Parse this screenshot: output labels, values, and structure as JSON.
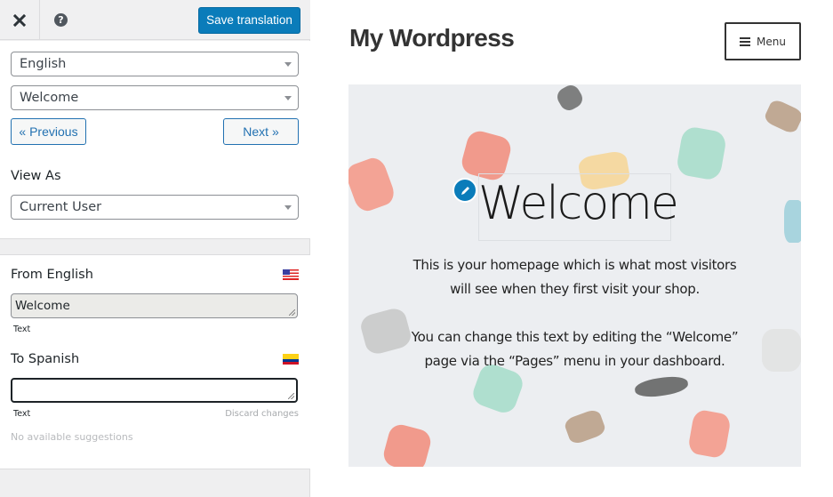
{
  "sidebar": {
    "topbar": {
      "close_icon": "close-icon",
      "help_icon": "help-icon",
      "help_glyph": "?",
      "save_label": "Save translation",
      "save_color": "#0a7cba"
    },
    "language_select": {
      "value": "English"
    },
    "string_select": {
      "value": "Welcome"
    },
    "previous_label": "« Previous",
    "next_label": "Next »",
    "view_as": {
      "label": "View As",
      "value": "Current User"
    },
    "source": {
      "label": "From English",
      "flag": "us-flag",
      "value": "Welcome",
      "type_label": "Text"
    },
    "target": {
      "label": "To Spanish",
      "flag": "colombia-flag",
      "value": "",
      "type_label": "Text",
      "discard_label": "Discard changes",
      "suggestions_text": "No available suggestions"
    }
  },
  "preview": {
    "site_title": "My Wordpress",
    "menu_label": "Menu",
    "hero": {
      "title": "Welcome",
      "paragraph1_line1": "This is your homepage which is what most visitors",
      "paragraph1_line2": "will see when they first visit your shop.",
      "paragraph2_line1": "You can change this text by editing the “Welcome”",
      "paragraph2_line2": "page via the “Pages” menu in your dashboard.",
      "edit_icon": "pencil-icon",
      "edit_color": "#0a7cba"
    }
  }
}
